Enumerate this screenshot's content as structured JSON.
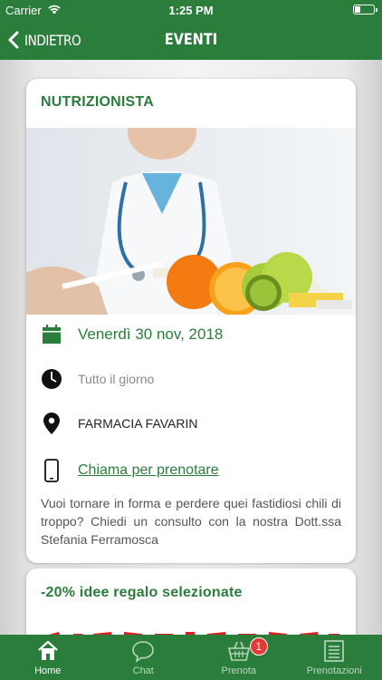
{
  "status_bar": {
    "carrier": "Carrier",
    "time": "1:25 PM"
  },
  "nav": {
    "back_label": "INDIETRO",
    "title": "EVENTI"
  },
  "events": [
    {
      "title": "NUTRIZIONISTA",
      "date": "Venerdì 30 nov, 2018",
      "time": "Tutto il giorno",
      "place": "FARMACIA FAVARIN",
      "call_label": "Chiama per prenotare",
      "description": "Vuoi tornare in forma e perdere quei fastidiosi chili di troppo? Chiedi un consulto con la nostra Dott.ssa Stefania Ferramosca"
    },
    {
      "title": "-20% idee regalo selezionate"
    }
  ],
  "tabs": [
    {
      "label": "Home",
      "icon": "home-icon",
      "active": true
    },
    {
      "label": "Chat",
      "icon": "chat-icon",
      "active": false
    },
    {
      "label": "Prenota",
      "icon": "basket-icon",
      "active": false,
      "badge": "1"
    },
    {
      "label": "Prenotazioni",
      "icon": "list-icon",
      "active": false
    }
  ],
  "colors": {
    "primary": "#2a7d3b",
    "badge": "#e53935",
    "promo_red": "#d9201f"
  }
}
